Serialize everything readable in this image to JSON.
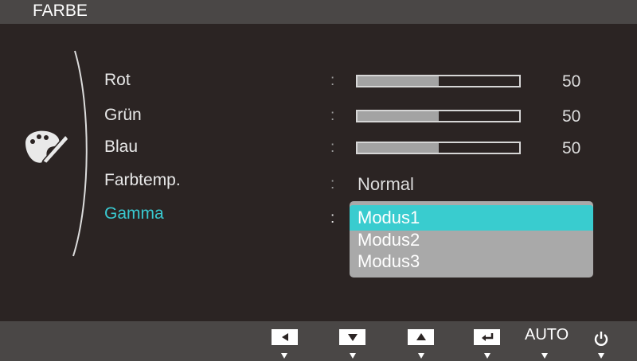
{
  "header": {
    "title": "FARBE"
  },
  "menu": {
    "items": [
      {
        "label": "Rot",
        "value": "50",
        "level": 50
      },
      {
        "label": "Grün",
        "value": "50",
        "level": 50
      },
      {
        "label": "Blau",
        "value": "50",
        "level": 50
      },
      {
        "label": "Farbtemp.",
        "value": "Normal"
      },
      {
        "label": "Gamma"
      }
    ],
    "separator": ":",
    "gamma_options": [
      "Modus1",
      "Modus2",
      "Modus3"
    ],
    "gamma_selected": "Modus1"
  },
  "footer": {
    "buttons": [
      {
        "icon": "left-arrow-icon"
      },
      {
        "icon": "down-arrow-icon"
      },
      {
        "icon": "up-arrow-icon"
      },
      {
        "icon": "enter-icon"
      },
      {
        "label": "AUTO"
      },
      {
        "icon": "power-icon"
      }
    ]
  },
  "colors": {
    "accent": "#39cccf",
    "background": "#2b2423",
    "bar": "#4a4746",
    "dropdown": "#a9a9a9"
  }
}
